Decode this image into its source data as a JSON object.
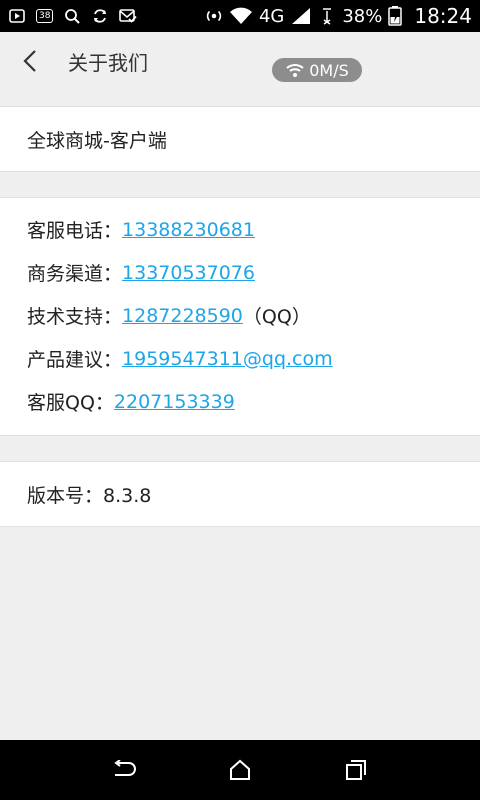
{
  "status_bar": {
    "notification_badge": "38",
    "network_type": "4G",
    "battery_percent": "38%",
    "time": "18:24"
  },
  "header": {
    "title": "关于我们",
    "network_speed": "0M/S"
  },
  "app_section": {
    "app_name": "全球商城-客户端"
  },
  "contact_section": {
    "rows": [
      {
        "label": "客服电话：",
        "value": "13388230681",
        "suffix": ""
      },
      {
        "label": "商务渠道：",
        "value": "13370537076",
        "suffix": ""
      },
      {
        "label": "技术支持：",
        "value": "1287228590",
        "suffix": "（QQ）"
      },
      {
        "label": "产品建议：",
        "value": "1959547311@qq.com",
        "suffix": ""
      },
      {
        "label": "客服QQ：",
        "value": "2207153339",
        "suffix": ""
      }
    ]
  },
  "version_section": {
    "version": "版本号：8.3.8"
  },
  "colors": {
    "link": "#1ea5e8",
    "background": "#efefef",
    "status_bar": "#000000"
  },
  "icons": {
    "status_left": [
      "image-icon",
      "notification-count-icon",
      "search-icon",
      "sync-icon",
      "mail-check-icon"
    ],
    "status_right": [
      "wifi-icon",
      "signal-icon",
      "battery-icon"
    ],
    "nav": [
      "back-icon",
      "home-icon",
      "recents-icon"
    ]
  }
}
